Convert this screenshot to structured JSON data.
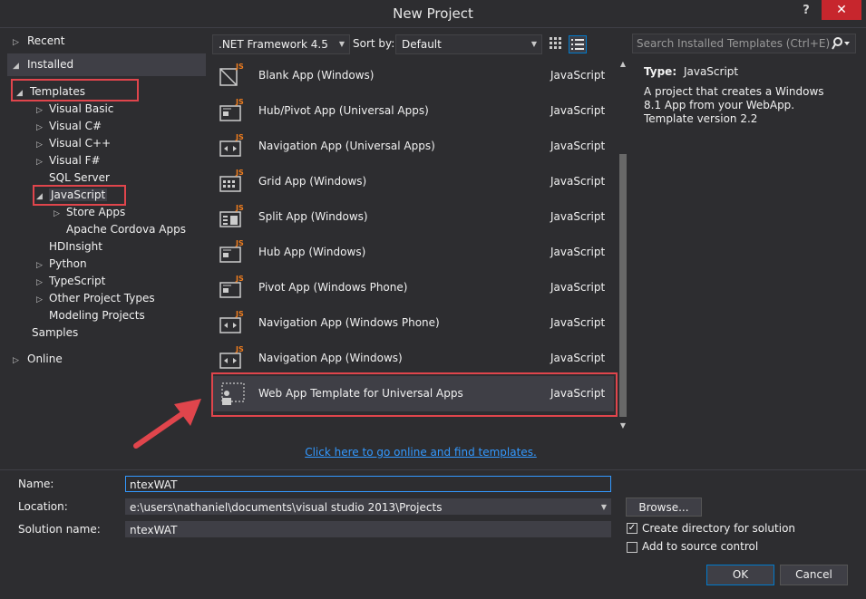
{
  "window": {
    "title": "New Project",
    "help": "?",
    "close": "✕"
  },
  "tree": {
    "recent": "Recent",
    "installed": "Installed",
    "templates": "Templates",
    "visual_basic": "Visual Basic",
    "visual_csharp": "Visual C#",
    "visual_cpp": "Visual C++",
    "visual_fsharp": "Visual F#",
    "sql_server": "SQL Server",
    "javascript": "JavaScript",
    "store_apps": "Store Apps",
    "apache_cordova": "Apache Cordova Apps",
    "hdinsight": "HDInsight",
    "python": "Python",
    "typescript": "TypeScript",
    "other_project_types": "Other Project Types",
    "modeling_projects": "Modeling Projects",
    "samples": "Samples",
    "online": "Online"
  },
  "toolbar": {
    "framework": ".NET Framework 4.5",
    "sort_label": "Sort by:",
    "sort_value": "Default",
    "search_placeholder": "Search Installed Templates (Ctrl+E)"
  },
  "templates": [
    {
      "name": "Blank App (Windows)",
      "lang": "JavaScript"
    },
    {
      "name": "Hub/Pivot App (Universal Apps)",
      "lang": "JavaScript"
    },
    {
      "name": "Navigation App (Universal Apps)",
      "lang": "JavaScript"
    },
    {
      "name": "Grid App (Windows)",
      "lang": "JavaScript"
    },
    {
      "name": "Split App (Windows)",
      "lang": "JavaScript"
    },
    {
      "name": "Hub App (Windows)",
      "lang": "JavaScript"
    },
    {
      "name": "Pivot App (Windows Phone)",
      "lang": "JavaScript"
    },
    {
      "name": "Navigation App (Windows Phone)",
      "lang": "JavaScript"
    },
    {
      "name": "Navigation App (Windows)",
      "lang": "JavaScript"
    },
    {
      "name": "Web App Template for Universal Apps",
      "lang": "JavaScript"
    }
  ],
  "details": {
    "type_label": "Type:",
    "type_value": "JavaScript",
    "description": "A project that creates a Windows 8.1 App from your WebApp. Template version 2.2"
  },
  "online_link": "Click here to go online and find templates.",
  "form": {
    "name_label": "Name:",
    "name_value": "ntexWAT",
    "location_label": "Location:",
    "location_value": "e:\\users\\nathaniel\\documents\\visual studio 2013\\Projects",
    "solution_label": "Solution name:",
    "solution_value": "ntexWAT",
    "browse": "Browse...",
    "create_dir": "Create directory for solution",
    "add_source": "Add to source control",
    "ok": "OK",
    "cancel": "Cancel"
  },
  "colors": {
    "accent": "#007acc",
    "highlight_box": "#e0454c",
    "link": "#3399ff",
    "icon_js": "#f07d1e"
  }
}
